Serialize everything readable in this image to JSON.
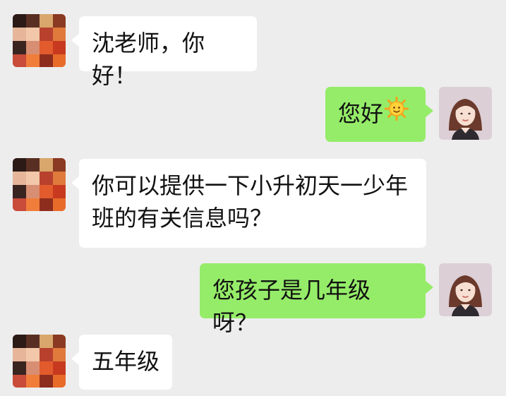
{
  "chat": {
    "messages": [
      {
        "sender": "teacher",
        "side": "left",
        "text": "沈老师，你好！"
      },
      {
        "sender": "me",
        "side": "right",
        "text": "您好",
        "emoji": "sun-emoji"
      },
      {
        "sender": "teacher",
        "side": "left",
        "text": "你可以提供一下小升初天一少年班的有关信息吗？"
      },
      {
        "sender": "me",
        "side": "right",
        "text": "您孩子是几年级呀？"
      },
      {
        "sender": "teacher",
        "side": "left",
        "text": "五年级"
      }
    ]
  },
  "colors": {
    "background": "#ededed",
    "incoming_bubble": "#ffffff",
    "outgoing_bubble": "#95ec69",
    "text": "#111111"
  }
}
